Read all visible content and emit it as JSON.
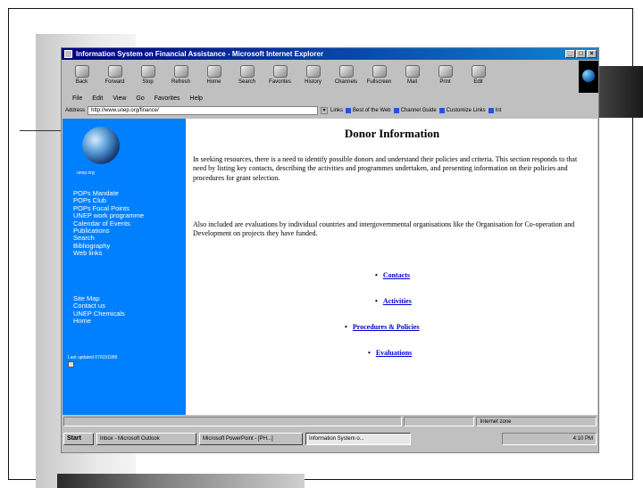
{
  "window": {
    "title": "Information System on Financial Assistance - Microsoft Internet Explorer"
  },
  "toolbar": [
    "Back",
    "Forward",
    "Stop",
    "Refresh",
    "Home",
    "Search",
    "Favorites",
    "History",
    "Channels",
    "Fullscreen",
    "Mail",
    "Print",
    "Edit"
  ],
  "menu": [
    "File",
    "Edit",
    "View",
    "Go",
    "Favorites",
    "Help"
  ],
  "address": {
    "label": "Address",
    "url": "http://www.unep.org/finance/",
    "links_label": "Links",
    "links": [
      "Best of the Web",
      "Channel Guide",
      "Customize Links",
      "Int"
    ]
  },
  "sidebar": {
    "globe_caption": "unep.org",
    "nav_group1": [
      "POPs Mandate",
      "POPs Club",
      "POPs Focal Points",
      "UNEP work programme",
      "Calendar of Events",
      "Publications",
      "Search",
      "Bibliography",
      "Web links"
    ],
    "nav_group2": [
      "Site Map",
      "Contact us",
      "UNEP Chemicals",
      "Home"
    ],
    "updated": "Last updated 07/03/1999"
  },
  "main": {
    "heading": "Donor Information",
    "para1": "In seeking resources, there is a need to identify possible donors and understand their policies and criteria. This section responds to that need by listing key contacts, describing the activities and programmes undertaken, and presenting information on their policies and procedures for grant selection.",
    "para2": "Also included are evaluations by individual countries and intergovernmental organisations like the Organisation for Co-operation and Development on projects they have funded.",
    "links": [
      "Contacts",
      "Activities",
      "Procedures & Policies",
      "Evaluations"
    ]
  },
  "statusbar": {
    "left": "",
    "zone": "Internet zone"
  },
  "taskbar": {
    "start": "Start",
    "tasks": [
      "Inbox - Microsoft Outlook",
      "Microsoft PowerPoint - [PH...]",
      "Information System o..."
    ],
    "clock": "4:10 PM"
  }
}
